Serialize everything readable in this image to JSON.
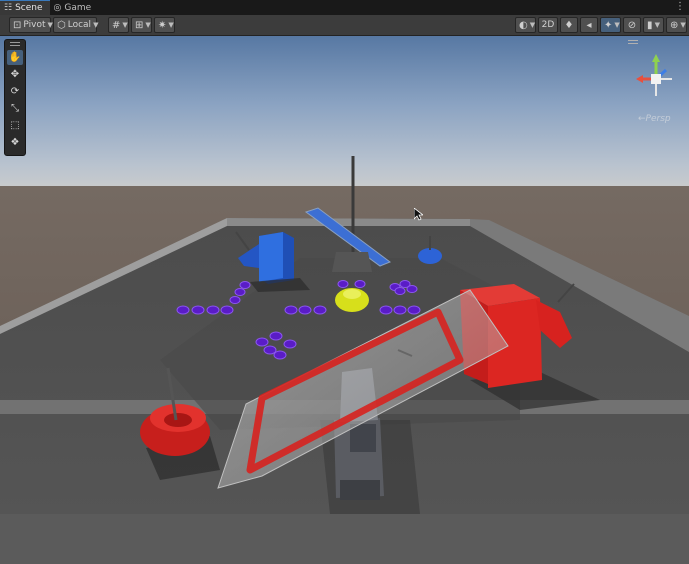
{
  "tabs": [
    {
      "label": "Scene",
      "icon": "scene-icon",
      "active": true
    },
    {
      "label": "Game",
      "icon": "game-icon",
      "active": false
    }
  ],
  "toolbar": {
    "pivot_label": "Pivot",
    "local_label": "Local",
    "mode_2d_label": "2D"
  },
  "tools": [
    {
      "name": "hand-tool",
      "glyph": "✋",
      "selected": true
    },
    {
      "name": "move-tool",
      "glyph": "✥",
      "selected": false
    },
    {
      "name": "rotate-tool",
      "glyph": "⟳",
      "selected": false
    },
    {
      "name": "scale-tool",
      "glyph": "⤡",
      "selected": false
    },
    {
      "name": "rect-tool",
      "glyph": "⬚",
      "selected": false
    },
    {
      "name": "transform-tool",
      "glyph": "❖",
      "selected": false
    }
  ],
  "gizmo": {
    "axes": {
      "x": "#e8503e",
      "y": "#8fd14f",
      "z": "#3d7ee6"
    },
    "projection_label": "←Persp"
  },
  "scene_colors": {
    "sky_top": "#5679a4",
    "horizon": "#c4c7c8",
    "ground": "#6c5f57",
    "floor": "#505050",
    "red_objects": "#d7221f",
    "blue_objects": "#2b62d1",
    "purple_items": "#5b1dc8",
    "yellow_item": "#d6df1a"
  }
}
